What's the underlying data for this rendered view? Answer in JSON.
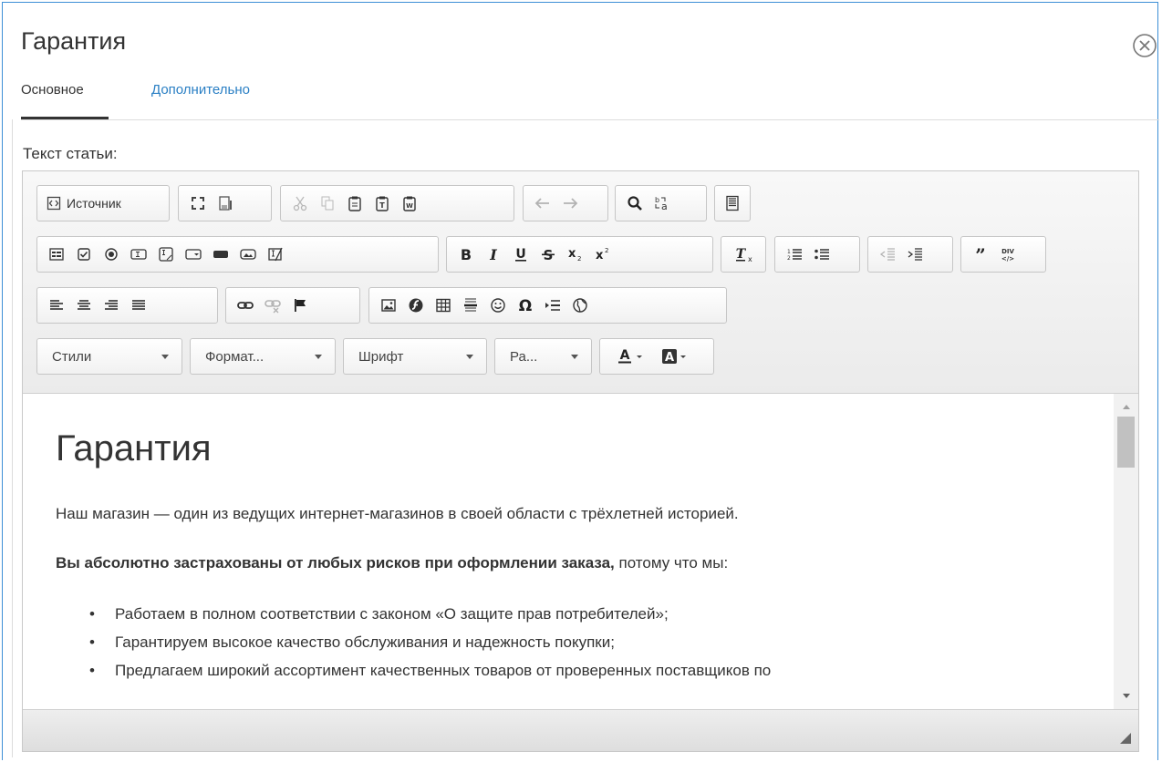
{
  "dialog": {
    "title": "Гарантия",
    "tabs": [
      {
        "label": "Основное",
        "active": true
      },
      {
        "label": "Дополнительно",
        "active": false
      }
    ],
    "field_label": "Текст статьи:"
  },
  "toolbar": {
    "source_label": "Источник",
    "combos": [
      {
        "label": "Стили"
      },
      {
        "label": "Формат..."
      },
      {
        "label": "Шрифт"
      },
      {
        "label": "Ра..."
      }
    ]
  },
  "content": {
    "heading": "Гарантия",
    "paragraph1": "Наш магазин — один из ведущих интернет-магазинов в своей области с трёхлетней историей.",
    "paragraph2_bold": "Вы абсолютно застрахованы от любых рисков при оформлении заказа,",
    "paragraph2_rest": " потому что мы:",
    "list": [
      "Работаем в полном соответствии с законом «О защите прав потребителей»;",
      "Гарантируем высокое качество обслуживания и надежность покупки;",
      "Предлагаем широкий ассортимент качественных товаров от проверенных поставщиков по"
    ]
  },
  "colors": {
    "accent": "#2a7fc4",
    "border": "#3d8fd6"
  }
}
